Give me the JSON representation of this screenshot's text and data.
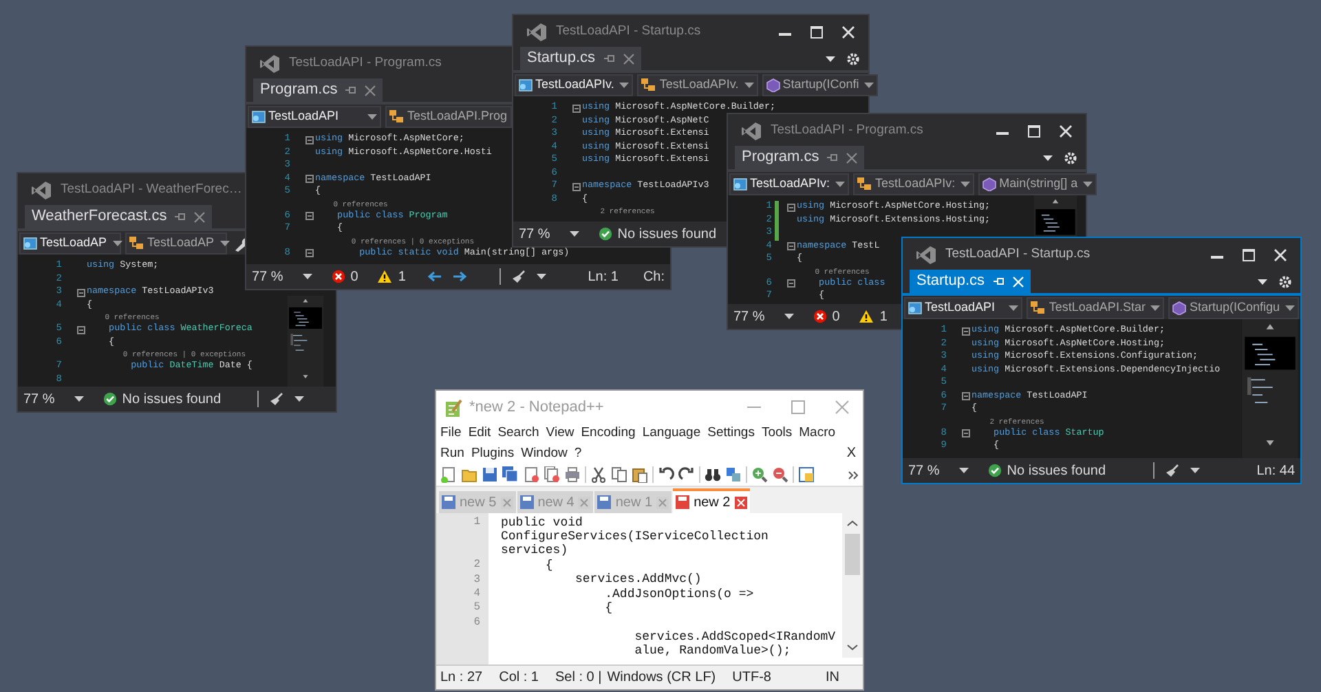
{
  "vs_windows": [
    {
      "title": "TestLoadAPI - WeatherForec…",
      "active": false,
      "title_buttons": false,
      "minimap": true,
      "tab": "WeatherForecast.cs",
      "dropdowns": [
        {
          "kind": "project",
          "label": "TestLoadAP"
        },
        {
          "kind": "class",
          "label": "TestLoadAP"
        },
        {
          "kind": "wrench"
        }
      ],
      "lines": [
        {
          "kind": "code",
          "number": "1",
          "parts": [
            {
              "kind": "keyword",
              "text": "using"
            },
            {
              "kind": "plain",
              "text": " System;"
            }
          ]
        },
        {
          "kind": "code",
          "number": "2"
        },
        {
          "kind": "code",
          "number": "3",
          "fold": true,
          "parts": [
            {
              "kind": "keyword",
              "text": "namespace"
            },
            {
              "kind": "plain",
              "text": " TestLoadAPIv3"
            }
          ]
        },
        {
          "kind": "code",
          "number": "4",
          "parts": [
            {
              "kind": "plain",
              "text": "{"
            }
          ]
        },
        {
          "kind": "lens",
          "text": "    0 references"
        },
        {
          "kind": "code",
          "number": "5",
          "fold": true,
          "parts": [
            {
              "kind": "keyword",
              "text": "    public class"
            },
            {
              "kind": "type",
              "text": " WeatherForeca"
            }
          ]
        },
        {
          "kind": "code",
          "number": "6",
          "parts": [
            {
              "kind": "plain",
              "text": "    {"
            }
          ]
        },
        {
          "kind": "lens",
          "text": "        0 references | 0 exceptions"
        },
        {
          "kind": "code",
          "number": "7",
          "parts": [
            {
              "kind": "keyword",
              "text": "        public"
            },
            {
              "kind": "type",
              "text": " DateTime"
            },
            {
              "kind": "plain",
              "text": " Date {"
            }
          ]
        },
        {
          "kind": "code",
          "number": "8"
        }
      ],
      "status": {
        "zoom": "77 %",
        "message": "No issues found",
        "broom": true
      }
    },
    {
      "title": "TestLoadAPI - Program.cs",
      "active": false,
      "title_buttons": false,
      "minimap": false,
      "tab": "Program.cs",
      "dropdowns": [
        {
          "kind": "project",
          "label": "TestLoadAPI"
        },
        {
          "kind": "class",
          "label": "TestLoadAPI.Prog"
        }
      ],
      "lines": [
        {
          "kind": "code",
          "number": "1",
          "fold": true,
          "parts": [
            {
              "kind": "keyword",
              "text": "using"
            },
            {
              "kind": "plain",
              "text": " Microsoft.AspNetCore;"
            }
          ]
        },
        {
          "kind": "code",
          "number": "2",
          "parts": [
            {
              "kind": "keyword",
              "text": "using"
            },
            {
              "kind": "plain",
              "text": " Microsoft.AspNetCore.Hosti"
            }
          ]
        },
        {
          "kind": "code",
          "number": "3"
        },
        {
          "kind": "code",
          "number": "4",
          "fold": true,
          "parts": [
            {
              "kind": "keyword",
              "text": "namespace"
            },
            {
              "kind": "plain",
              "text": " TestLoadAPI"
            }
          ]
        },
        {
          "kind": "code",
          "number": "5",
          "parts": [
            {
              "kind": "plain",
              "text": "{"
            }
          ]
        },
        {
          "kind": "lens",
          "text": "    0 references"
        },
        {
          "kind": "code",
          "number": "6",
          "fold": true,
          "parts": [
            {
              "kind": "keyword",
              "text": "    public class"
            },
            {
              "kind": "type",
              "text": " Program"
            }
          ]
        },
        {
          "kind": "code",
          "number": "7",
          "parts": [
            {
              "kind": "plain",
              "text": "    {"
            }
          ]
        },
        {
          "kind": "lens",
          "text": "        0 references | 0 exceptions"
        },
        {
          "kind": "code",
          "number": "8",
          "fold": true,
          "parts": [
            {
              "kind": "keyword",
              "text": "        public static void"
            },
            {
              "kind": "plain",
              "text": " Main(string[] args)"
            }
          ]
        }
      ],
      "status": {
        "zoom": "77 %",
        "errors": "0",
        "warnings": "1",
        "nav": true,
        "broom": true,
        "ln": "Ln: 1",
        "ch": "Ch:"
      }
    },
    {
      "title": "TestLoadAPI - Startup.cs",
      "active": false,
      "title_buttons": true,
      "minimap": false,
      "tab": "Startup.cs",
      "dropdowns": [
        {
          "kind": "project",
          "label": "TestLoadAPIv."
        },
        {
          "kind": "class",
          "label": "TestLoadAPIv."
        },
        {
          "kind": "method",
          "label": "Startup(IConfi"
        }
      ],
      "lines": [
        {
          "kind": "code",
          "number": "1",
          "fold": true,
          "parts": [
            {
              "kind": "keyword",
              "text": "using"
            },
            {
              "kind": "plain",
              "text": " Microsoft.AspNetCore.Builder;"
            }
          ]
        },
        {
          "kind": "code",
          "number": "2",
          "parts": [
            {
              "kind": "keyword",
              "text": "using"
            },
            {
              "kind": "plain",
              "text": " Microsoft.AspNetC"
            }
          ]
        },
        {
          "kind": "code",
          "number": "3",
          "parts": [
            {
              "kind": "keyword",
              "text": "using"
            },
            {
              "kind": "plain",
              "text": " Microsoft.Extensi"
            }
          ]
        },
        {
          "kind": "code",
          "number": "4",
          "parts": [
            {
              "kind": "keyword",
              "text": "using"
            },
            {
              "kind": "plain",
              "text": " Microsoft.Extensi"
            }
          ]
        },
        {
          "kind": "code",
          "number": "5",
          "parts": [
            {
              "kind": "keyword",
              "text": "using"
            },
            {
              "kind": "plain",
              "text": " Microsoft.Extensi"
            }
          ]
        },
        {
          "kind": "code",
          "number": "6"
        },
        {
          "kind": "code",
          "number": "7",
          "fold": true,
          "parts": [
            {
              "kind": "keyword",
              "text": "namespace"
            },
            {
              "kind": "plain",
              "text": " TestLoadAPIv3"
            }
          ]
        },
        {
          "kind": "code",
          "number": "8",
          "parts": [
            {
              "kind": "plain",
              "text": "{"
            }
          ]
        },
        {
          "kind": "lens",
          "text": "    2 references"
        }
      ],
      "status": {
        "zoom": "77 %",
        "message": "No issues found"
      }
    },
    {
      "title": "TestLoadAPI - Program.cs",
      "active": false,
      "title_buttons": true,
      "minimap": true,
      "tab": "Program.cs",
      "dropdowns": [
        {
          "kind": "project",
          "label": "TestLoadAPIv:"
        },
        {
          "kind": "class",
          "label": "TestLoadAPIv:"
        },
        {
          "kind": "method",
          "label": "Main(string[] a"
        }
      ],
      "lines": [
        {
          "kind": "code",
          "number": "1",
          "fold": true,
          "changed": true,
          "parts": [
            {
              "kind": "keyword",
              "text": "using"
            },
            {
              "kind": "plain",
              "text": " Microsoft.AspNetCore.Hosting;"
            }
          ]
        },
        {
          "kind": "code",
          "number": "2",
          "changed": true,
          "parts": [
            {
              "kind": "keyword",
              "text": "using"
            },
            {
              "kind": "plain",
              "text": " Microsoft.Extensions.Hosting;"
            }
          ]
        },
        {
          "kind": "code",
          "number": "3",
          "changed": true
        },
        {
          "kind": "code",
          "number": "4",
          "fold": true,
          "parts": [
            {
              "kind": "keyword",
              "text": "namespace"
            },
            {
              "kind": "plain",
              "text": " TestL"
            }
          ]
        },
        {
          "kind": "code",
          "number": "5",
          "parts": [
            {
              "kind": "plain",
              "text": "{"
            }
          ]
        },
        {
          "kind": "lens",
          "text": "    0 references"
        },
        {
          "kind": "code",
          "number": "6",
          "fold": true,
          "parts": [
            {
              "kind": "keyword",
              "text": "    public class"
            }
          ]
        },
        {
          "kind": "code",
          "number": "7",
          "parts": [
            {
              "kind": "plain",
              "text": "    {"
            }
          ]
        }
      ],
      "status": {
        "zoom": "77 %",
        "errors": "0",
        "warnings": "1"
      }
    },
    {
      "title": "TestLoadAPI - Startup.cs",
      "active": true,
      "title_buttons": true,
      "minimap": true,
      "tab": "Startup.cs",
      "dropdowns": [
        {
          "kind": "project",
          "label": "TestLoadAPI"
        },
        {
          "kind": "class",
          "label": "TestLoadAPI.Star"
        },
        {
          "kind": "method",
          "label": "Startup(IConfigu"
        }
      ],
      "lines": [
        {
          "kind": "code",
          "number": "1",
          "fold": true,
          "parts": [
            {
              "kind": "keyword",
              "text": "using"
            },
            {
              "kind": "plain",
              "text": " Microsoft.AspNetCore.Builder;"
            }
          ]
        },
        {
          "kind": "code",
          "number": "2",
          "parts": [
            {
              "kind": "keyword",
              "text": "using"
            },
            {
              "kind": "plain",
              "text": " Microsoft.AspNetCore.Hosting;"
            }
          ]
        },
        {
          "kind": "code",
          "number": "3",
          "parts": [
            {
              "kind": "keyword",
              "text": "using"
            },
            {
              "kind": "plain",
              "text": " Microsoft.Extensions.Configuration;"
            }
          ]
        },
        {
          "kind": "code",
          "number": "4",
          "parts": [
            {
              "kind": "keyword",
              "text": "using"
            },
            {
              "kind": "plain",
              "text": " Microsoft.Extensions.DependencyInjectio"
            }
          ]
        },
        {
          "kind": "code",
          "number": "5"
        },
        {
          "kind": "code",
          "number": "6",
          "fold": true,
          "parts": [
            {
              "kind": "keyword",
              "text": "namespace"
            },
            {
              "kind": "plain",
              "text": " TestLoadAPI"
            }
          ]
        },
        {
          "kind": "code",
          "number": "7",
          "parts": [
            {
              "kind": "plain",
              "text": "{"
            }
          ]
        },
        {
          "kind": "lens",
          "text": "    2 references"
        },
        {
          "kind": "code",
          "number": "8",
          "fold": true,
          "parts": [
            {
              "kind": "keyword",
              "text": "    public class"
            },
            {
              "kind": "type",
              "text": " Startup"
            }
          ]
        },
        {
          "kind": "code",
          "number": "9",
          "parts": [
            {
              "kind": "plain",
              "text": "    {"
            }
          ]
        }
      ],
      "status": {
        "zoom": "77 %",
        "message": "No issues found",
        "broom": true,
        "ln": "Ln: 44"
      }
    }
  ],
  "notepad": {
    "title": "*new 2 - Notepad++",
    "menu_rows": [
      [
        "File",
        "Edit",
        "Search",
        "View",
        "Encoding",
        "Language",
        "Settings",
        "Tools",
        "Macro"
      ],
      [
        "Run",
        "Plugins",
        "Window",
        "?"
      ]
    ],
    "close_document": "X",
    "tabs": [
      {
        "label": "new 5",
        "selected": false
      },
      {
        "label": "new 4",
        "selected": false
      },
      {
        "label": "new 1",
        "selected": false
      },
      {
        "label": "new 2",
        "selected": true
      }
    ],
    "lines": [
      {
        "number": "1",
        "rows": [
          "public void",
          "ConfigureServices(IServiceCollection",
          "services)"
        ]
      },
      {
        "number": "2",
        "rows": [
          "      {"
        ]
      },
      {
        "number": "3",
        "rows": [
          "          services.AddMvc()"
        ]
      },
      {
        "number": "4",
        "rows": [
          "              .AddJsonOptions(o =>"
        ]
      },
      {
        "number": "5",
        "rows": [
          "              {"
        ]
      },
      {
        "number": "6",
        "rows": [
          "",
          "                  services.AddScoped<IRandomV",
          "                  alue, RandomValue>();"
        ]
      }
    ],
    "status": [
      "Ln : 27",
      "Col : 1",
      "Sel : 0 |",
      "Windows (CR LF)",
      "UTF-8",
      "IN"
    ]
  }
}
